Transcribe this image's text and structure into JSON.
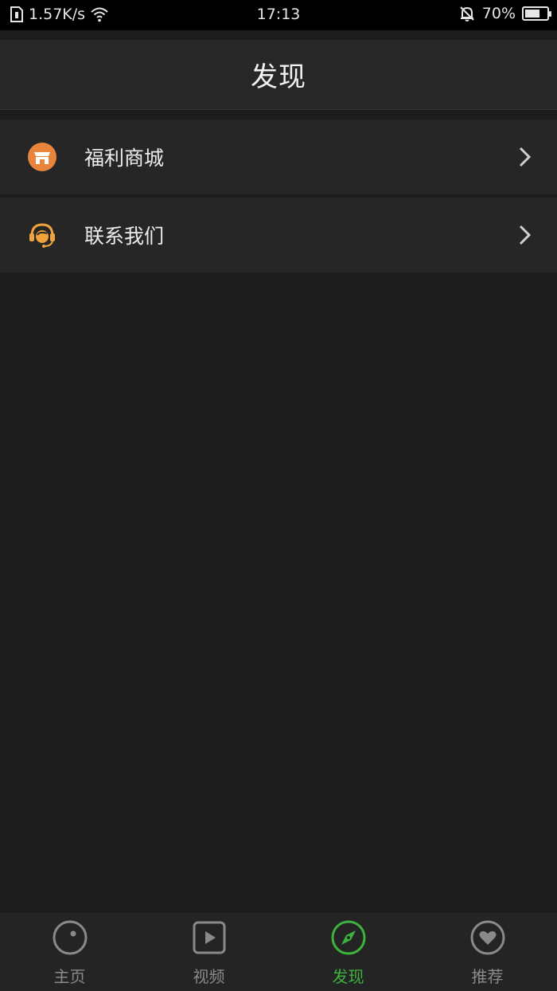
{
  "status_bar": {
    "speed": "1.57K/s",
    "time": "17:13",
    "battery": "70%",
    "battery_level": 0.7
  },
  "header": {
    "title": "发现"
  },
  "menu": {
    "items": [
      {
        "label": "福利商城",
        "icon": "store-icon"
      },
      {
        "label": "联系我们",
        "icon": "headset-icon"
      }
    ]
  },
  "tabs": [
    {
      "label": "主页",
      "icon": "home-icon"
    },
    {
      "label": "视频",
      "icon": "video-icon"
    },
    {
      "label": "发现",
      "icon": "compass-icon",
      "active": true
    },
    {
      "label": "推荐",
      "icon": "heart-icon"
    }
  ],
  "colors": {
    "accent": "#3db23d",
    "store_orange": "#e8853a",
    "headset_orange": "#f0a33a"
  }
}
